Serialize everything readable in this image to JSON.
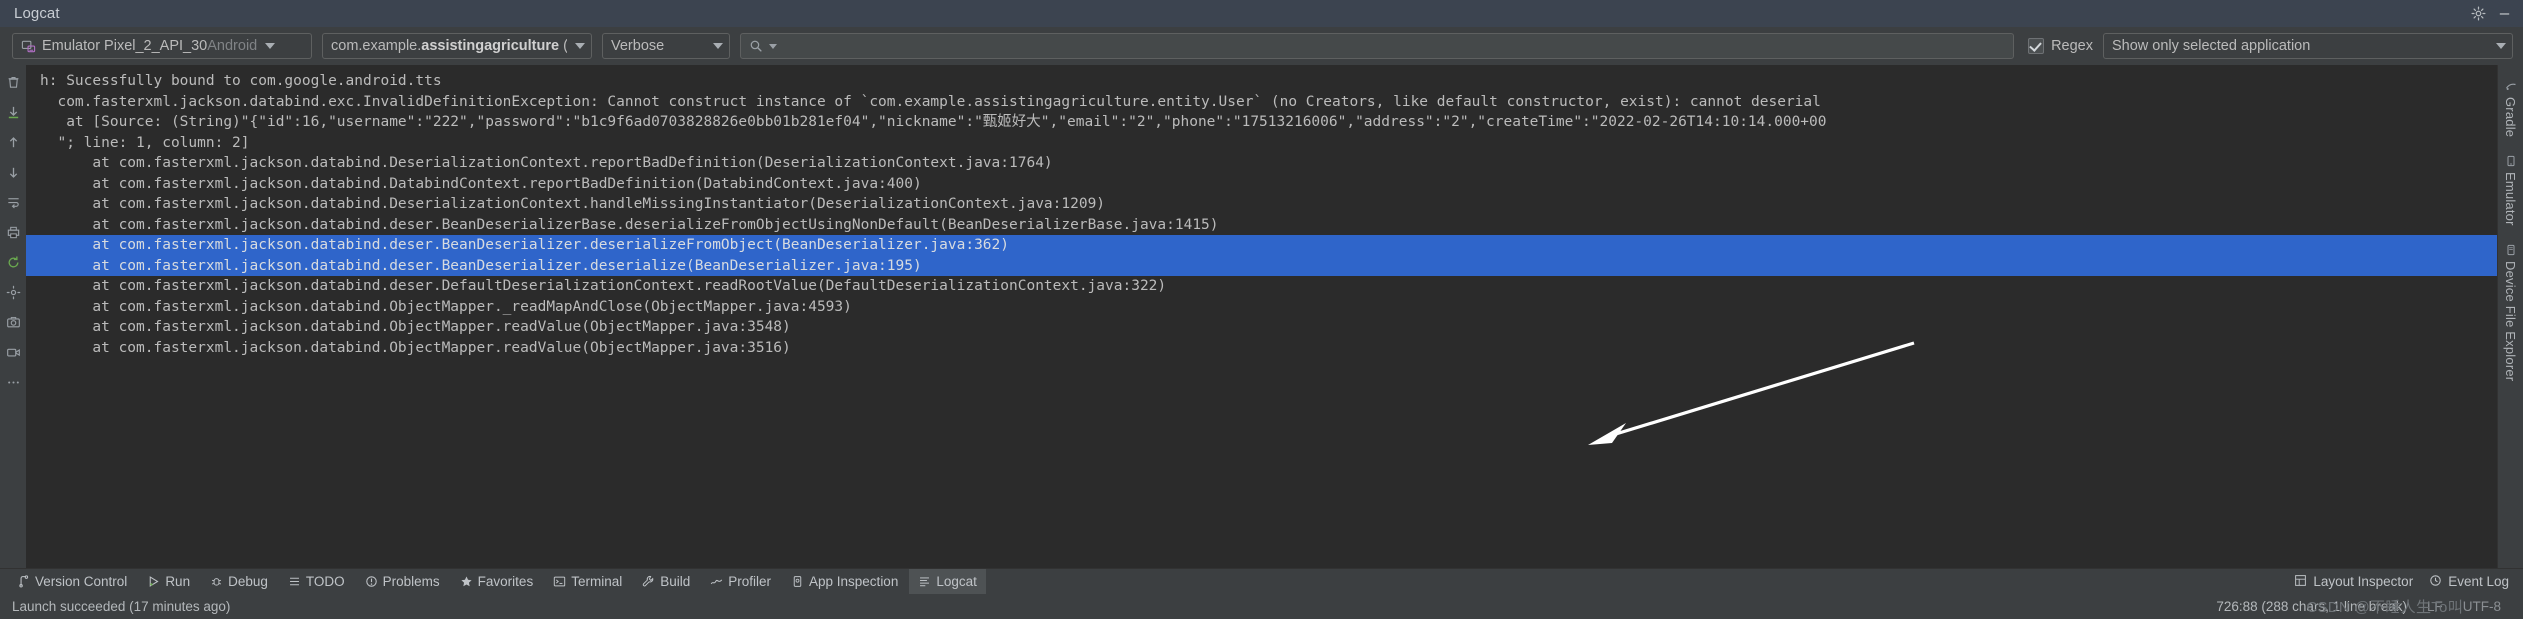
{
  "window": {
    "title": "Logcat",
    "settings_icon": "gear-icon",
    "minimize_icon": "minimize-icon"
  },
  "toolbar": {
    "device": {
      "icon": "device-icon",
      "label": "Emulator Pixel_2_API_30 ",
      "label_dim": "Android",
      "caret": "chevron-down-icon"
    },
    "process": {
      "prefix": "com.example.",
      "strong": "assistingagriculture",
      "suffix": " (",
      "caret": "chevron-down-icon"
    },
    "level": {
      "label": "Verbose",
      "caret": "chevron-down-icon"
    },
    "search": {
      "icon": "search-icon",
      "value": "",
      "placeholder": ""
    },
    "regex": {
      "label": "Regex",
      "checked": true
    },
    "filter": {
      "label": "Show only selected application",
      "caret": "chevron-down-icon"
    }
  },
  "gutter_icons": [
    "clear-all-icon",
    "scroll-to-end-icon",
    "up-arrow-icon",
    "down-arrow-icon",
    "soft-wrap-icon",
    "print-icon",
    "restart-icon",
    "settings-icon",
    "screenshot-icon",
    "screen-record-icon",
    "more-icon"
  ],
  "console": {
    "lines": [
      {
        "text": "h: Sucessfully bound to com.google.android.tts",
        "selected": false
      },
      {
        "text": "  com.fasterxml.jackson.databind.exc.InvalidDefinitionException: Cannot construct instance of `com.example.assistingagriculture.entity.User` (no Creators, like default constructor, exist): cannot deserial",
        "selected": false
      },
      {
        "text": "   at [Source: (String)\"{\"id\":16,\"username\":\"222\",\"password\":\"b1c9f6ad0703828826e0bb01b281ef04\",\"nickname\":\"甄姬好大\",\"email\":\"2\",\"phone\":\"17513216006\",\"address\":\"2\",\"createTime\":\"2022-02-26T14:10:14.000+00",
        "selected": false
      },
      {
        "text": "  \"; line: 1, column: 2]",
        "selected": false
      },
      {
        "text": "      at com.fasterxml.jackson.databind.DeserializationContext.reportBadDefinition(DeserializationContext.java:1764)",
        "selected": false
      },
      {
        "text": "      at com.fasterxml.jackson.databind.DatabindContext.reportBadDefinition(DatabindContext.java:400)",
        "selected": false
      },
      {
        "text": "      at com.fasterxml.jackson.databind.DeserializationContext.handleMissingInstantiator(DeserializationContext.java:1209)",
        "selected": false
      },
      {
        "text": "      at com.fasterxml.jackson.databind.deser.BeanDeserializerBase.deserializeFromObjectUsingNonDefault(BeanDeserializerBase.java:1415)",
        "selected": false
      },
      {
        "text": "      at com.fasterxml.jackson.databind.deser.BeanDeserializer.deserializeFromObject(BeanDeserializer.java:362)",
        "selected": true
      },
      {
        "text": "      at com.fasterxml.jackson.databind.deser.BeanDeserializer.deserialize(BeanDeserializer.java:195)",
        "selected": true
      },
      {
        "text": "      at com.fasterxml.jackson.databind.deser.DefaultDeserializationContext.readRootValue(DefaultDeserializationContext.java:322)",
        "selected": false
      },
      {
        "text": "      at com.fasterxml.jackson.databind.ObjectMapper._readMapAndClose(ObjectMapper.java:4593)",
        "selected": false
      },
      {
        "text": "      at com.fasterxml.jackson.databind.ObjectMapper.readValue(ObjectMapper.java:3548)",
        "selected": false
      },
      {
        "text": "      at com.fasterxml.jackson.databind.ObjectMapper.readValue(ObjectMapper.java:3516)",
        "selected": false
      }
    ]
  },
  "right_tabs": [
    {
      "label": "Gradle",
      "icon": "gradle-icon"
    },
    {
      "label": "Emulator",
      "icon": "emulator-icon"
    },
    {
      "label": "Device File Explorer",
      "icon": "device-file-explorer-icon"
    }
  ],
  "bottom_tools": [
    {
      "label": "Version Control",
      "icon": "version-control-icon",
      "active": false
    },
    {
      "label": "Run",
      "icon": "run-icon",
      "active": false
    },
    {
      "label": "Debug",
      "icon": "debug-icon",
      "active": false
    },
    {
      "label": "TODO",
      "icon": "todo-icon",
      "active": false
    },
    {
      "label": "Problems",
      "icon": "problems-icon",
      "active": false
    },
    {
      "label": "Favorites",
      "icon": "favorites-icon",
      "active": false
    },
    {
      "label": "Terminal",
      "icon": "terminal-icon",
      "active": false
    },
    {
      "label": "Build",
      "icon": "build-icon",
      "active": false
    },
    {
      "label": "Profiler",
      "icon": "profiler-icon",
      "active": false
    },
    {
      "label": "App Inspection",
      "icon": "app-inspection-icon",
      "active": false
    },
    {
      "label": "Logcat",
      "icon": "logcat-icon",
      "active": true
    }
  ],
  "bottom_right": [
    {
      "label": "Layout Inspector",
      "icon": "layout-inspector-icon"
    },
    {
      "label": "Event Log",
      "icon": "event-log-icon"
    }
  ],
  "statusbar": {
    "message": "Launch succeeded (17 minutes ago)",
    "caret": "726:88 (288 chars, 1 line break)",
    "line_sep": "LF",
    "encoding": "UTF-8",
    "watermark": "CSDN @不睡人生To叫"
  },
  "colors": {
    "titlebar_bg": "#3c4450",
    "toolbar_bg": "#3c3f41",
    "console_bg": "#2b2b2b",
    "selection_bg": "#2f65ca",
    "text": "#bbbbbb"
  }
}
